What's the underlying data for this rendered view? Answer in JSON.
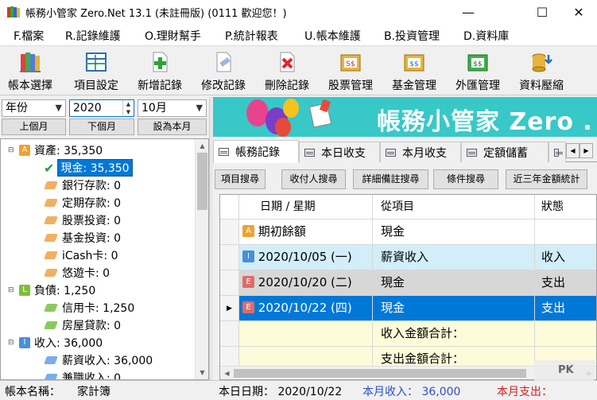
{
  "window": {
    "title": "帳務小管家 Zero.Net 13.1 (未註冊版) (0111 歡迎您！)",
    "minimize": "—",
    "maximize": "☐",
    "close": "✕"
  },
  "menu": [
    "F.檔案",
    "R.記錄維護",
    "O.理財幫手",
    "P.統計報表",
    "U.帳本維護",
    "B.投資管理",
    "D.資料庫"
  ],
  "toolbar": [
    {
      "label": "帳本選擇",
      "icon": "books-icon"
    },
    {
      "label": "項目設定",
      "icon": "ledger-icon"
    },
    {
      "label": "新增記錄",
      "icon": "add-record-icon"
    },
    {
      "label": "修改記錄",
      "icon": "edit-record-icon"
    },
    {
      "label": "刪除記錄",
      "icon": "delete-record-icon"
    },
    {
      "label": "股票管理",
      "icon": "stock-icon"
    },
    {
      "label": "基金管理",
      "icon": "fund-icon"
    },
    {
      "label": "外匯管理",
      "icon": "forex-icon"
    },
    {
      "label": "資料壓縮",
      "icon": "compress-icon"
    }
  ],
  "filter": {
    "period": "年份",
    "year": "2020",
    "month": "10月",
    "prev_month": "上個月",
    "next_month": "下個月",
    "set_this_month": "設為本月"
  },
  "tree": [
    {
      "type": "group",
      "badge": "A",
      "label": "資產: 35,350"
    },
    {
      "type": "leaf",
      "label": "現金: 35,350",
      "selected": true
    },
    {
      "type": "leaf",
      "label": "銀行存款: 0"
    },
    {
      "type": "leaf",
      "label": "定期存款: 0"
    },
    {
      "type": "leaf",
      "label": "股票投資: 0"
    },
    {
      "type": "leaf",
      "label": "基金投資: 0"
    },
    {
      "type": "leaf",
      "label": "iCash卡: 0"
    },
    {
      "type": "leaf",
      "label": "悠遊卡: 0"
    },
    {
      "type": "group",
      "badge": "L",
      "label": "負債: 1,250"
    },
    {
      "type": "leaf",
      "label": "信用卡: 1,250"
    },
    {
      "type": "leaf",
      "label": "房屋貸款: 0"
    },
    {
      "type": "group",
      "badge": "I",
      "label": "收入: 36,000"
    },
    {
      "type": "leaf",
      "label": "薪資收入: 36,000"
    },
    {
      "type": "leaf",
      "label": "兼職收入: 0"
    }
  ],
  "banner": {
    "title": "帳務小管家 Zero ."
  },
  "tabs": [
    "帳務記錄",
    "本日收支",
    "本月收支",
    "定額儲蓄"
  ],
  "subbuttons": [
    "項目搜尋",
    "收付人搜尋",
    "詳細備註搜尋",
    "條件搜尋",
    "近三年金額統計"
  ],
  "grid": {
    "columns": [
      "日期 / 星期",
      "從項目",
      "狀態"
    ],
    "rows": [
      {
        "badge": "A",
        "date": "期初餘額",
        "item": "現金",
        "status": ""
      },
      {
        "badge": "I",
        "date": "2020/10/05 (一)",
        "item": "薪資收入",
        "status": "收入"
      },
      {
        "badge": "E",
        "date": "2020/10/20 (二)",
        "item": "現金",
        "status": "支出"
      },
      {
        "badge": "E",
        "date": "2020/10/22 (四)",
        "item": "現金",
        "status": "支出"
      },
      {
        "badge": "",
        "date": "",
        "item": "收入金額合計：",
        "status": ""
      },
      {
        "badge": "",
        "date": "",
        "item": "支出金額合計：",
        "status": ""
      }
    ]
  },
  "status": {
    "ledger_label": "帳本名稱：",
    "ledger_name": "家計簿",
    "today": "本日日期： 2020/10/22",
    "income": "本月收入： 36,000",
    "expense": "本月支出："
  },
  "watermark": "PK",
  "colors": {
    "asset": "#f0a030",
    "liability": "#7cbf3a",
    "income": "#4a8fd8",
    "expense": "#e06a6a",
    "selection": "#0078d7",
    "banner": "#38c8c8",
    "row_income": "#d2eef8",
    "row_expense": "#d7d7d7",
    "row_total": "#fdfbd9"
  }
}
